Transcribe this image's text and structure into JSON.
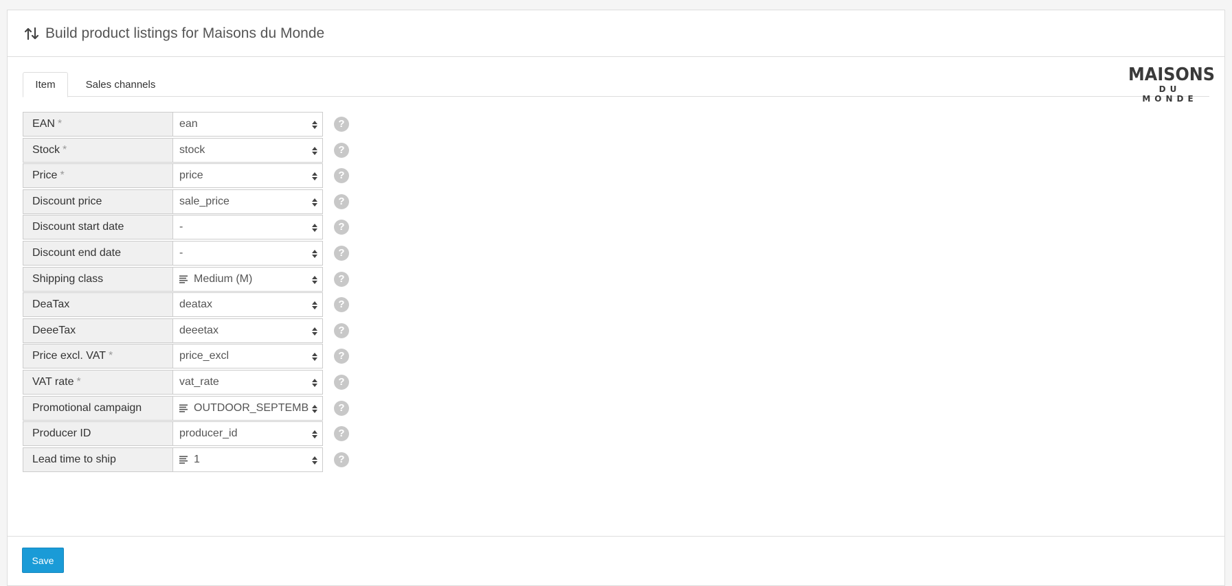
{
  "header": {
    "title": "Build product listings for Maisons du Monde",
    "icon": "sort-arrows-icon"
  },
  "tabs": [
    {
      "label": "Item",
      "active": true
    },
    {
      "label": "Sales channels",
      "active": false
    }
  ],
  "logo": {
    "line1": "MAISONS",
    "line2": "DU MONDE"
  },
  "fields": [
    {
      "label": "EAN",
      "required": true,
      "value": "ean",
      "list_icon": false
    },
    {
      "label": "Stock",
      "required": true,
      "value": "stock",
      "list_icon": false
    },
    {
      "label": "Price",
      "required": true,
      "value": "price",
      "list_icon": false
    },
    {
      "label": "Discount price",
      "required": false,
      "value": "sale_price",
      "list_icon": false
    },
    {
      "label": "Discount start date",
      "required": false,
      "value": "-",
      "list_icon": false
    },
    {
      "label": "Discount end date",
      "required": false,
      "value": "-",
      "list_icon": false
    },
    {
      "label": "Shipping class",
      "required": false,
      "value": "Medium (M)",
      "list_icon": true
    },
    {
      "label": "DeaTax",
      "required": false,
      "value": "deatax",
      "list_icon": false
    },
    {
      "label": "DeeeTax",
      "required": false,
      "value": "deeetax",
      "list_icon": false
    },
    {
      "label": "Price excl. VAT",
      "required": true,
      "value": "price_excl",
      "list_icon": false
    },
    {
      "label": "VAT rate",
      "required": true,
      "value": "vat_rate",
      "list_icon": false
    },
    {
      "label": "Promotional campaign",
      "required": false,
      "value": "OUTDOOR_SEPTEMBI",
      "list_icon": true
    },
    {
      "label": "Producer ID",
      "required": false,
      "value": "producer_id",
      "list_icon": false
    },
    {
      "label": "Lead time to ship",
      "required": false,
      "value": "1",
      "list_icon": true
    }
  ],
  "required_marker": "*",
  "help_glyph": "?",
  "save_label": "Save",
  "colors": {
    "primary_button": "#1a9bd7",
    "label_bg": "#f0f0f0",
    "help_icon": "#c8c8c8"
  }
}
